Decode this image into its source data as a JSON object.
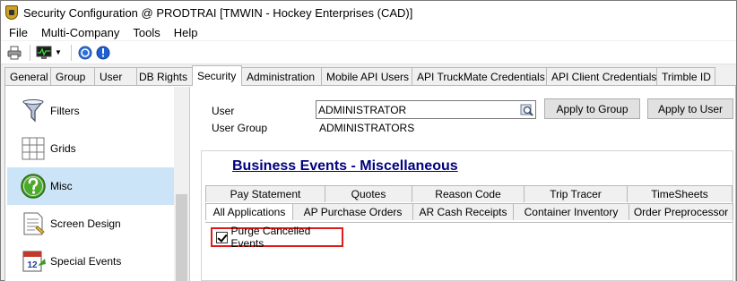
{
  "window": {
    "title": "Security Configuration @ PRODTRAI [TMWIN - Hockey Enterprises (CAD)]"
  },
  "menu": {
    "items": [
      "File",
      "Multi-Company",
      "Tools",
      "Help"
    ]
  },
  "toolbar": {
    "icons": [
      "printer-icon",
      "monitor-icon",
      "dropdown-arrow-icon",
      "help-icon",
      "info-icon"
    ]
  },
  "main_tabs": [
    {
      "label": "General"
    },
    {
      "label": "Group"
    },
    {
      "label": "User"
    },
    {
      "label": "DB Rights"
    },
    {
      "label": "Security",
      "active": true
    },
    {
      "label": "Administration"
    },
    {
      "label": "Mobile API Users"
    },
    {
      "label": "API TruckMate Credentials"
    },
    {
      "label": "API Client Credentials"
    },
    {
      "label": "Trimble ID"
    }
  ],
  "nav": {
    "items": [
      {
        "label": "Filters",
        "icon": "funnel-icon"
      },
      {
        "label": "Grids",
        "icon": "grid-icon"
      },
      {
        "label": "Misc",
        "icon": "question-icon",
        "selected": true
      },
      {
        "label": "Screen Design",
        "icon": "document-icon"
      },
      {
        "label": "Special Events",
        "icon": "calendar-icon"
      }
    ],
    "calendar_day": "12"
  },
  "form": {
    "user_label": "User",
    "user_value": "ADMINISTRATOR",
    "group_label": "User Group",
    "group_value": "ADMINISTRATORS",
    "apply_group_label": "Apply to Group",
    "apply_user_label": "Apply to User"
  },
  "panel": {
    "title": "Business Events - Miscellaneous",
    "tabs_row1": [
      "Pay Statement",
      "Quotes",
      "Reason Code",
      "Trip Tracer",
      "TimeSheets"
    ],
    "tabs_row2": [
      "All Applications",
      "AP Purchase Orders",
      "AR Cash Receipts",
      "Container Inventory",
      "Order Preprocessor"
    ],
    "purge_label": "Purge Cancelled Events",
    "purge_checked": true
  },
  "colors": {
    "accent": "#00007f",
    "highlight": "#cce4f7",
    "callout": "#e01b1b"
  }
}
